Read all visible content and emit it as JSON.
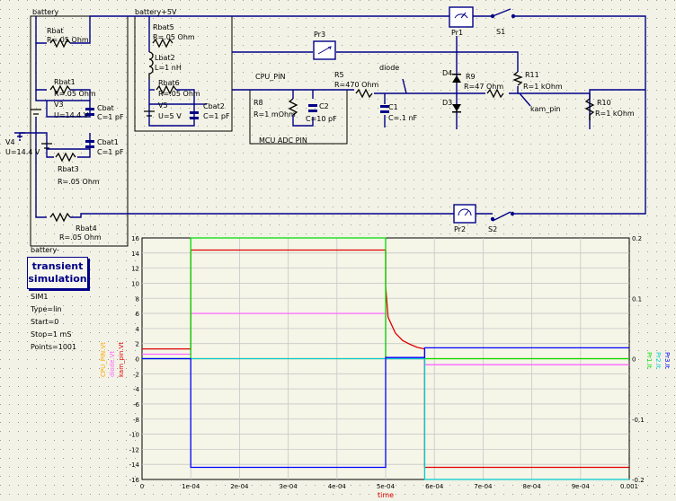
{
  "groups": {
    "battery": "battery",
    "battery_plus5v": "battery+5V",
    "battery_minus": "battery-",
    "mcu_adc": "MCU ADC PIN"
  },
  "components": {
    "rbat": {
      "name": "Rbat",
      "value": "R=.05 Ohm"
    },
    "rbat1": {
      "name": "Rbat1",
      "value": "R=.05 Ohm"
    },
    "v3": {
      "name": "V3",
      "value": "U=14.4 V"
    },
    "cbat": {
      "name": "Cbat",
      "value": "C=1 pF"
    },
    "v4": {
      "name": "V4",
      "value": "U=14.4 V"
    },
    "cbat1": {
      "name": "Cbat1",
      "value": "C=1 pF"
    },
    "rbat3": {
      "name": "Rbat3",
      "value": "R=.05 Ohm"
    },
    "rbat4": {
      "name": "Rbat4",
      "value": "R=.05 Ohm"
    },
    "rbat5": {
      "name": "Rbat5",
      "value": "R=.05 Ohm"
    },
    "lbat2": {
      "name": "Lbat2",
      "value": "L=1 nH"
    },
    "rbat6": {
      "name": "Rbat6",
      "value": "R=.05 Ohm"
    },
    "v5": {
      "name": "V5",
      "value": "U=5 V"
    },
    "cbat2": {
      "name": "Cbat2",
      "value": "C=1 pF"
    },
    "pr3": {
      "name": "Pr3"
    },
    "pr1": {
      "name": "Pr1"
    },
    "pr2": {
      "name": "Pr2"
    },
    "s1": {
      "name": "S1"
    },
    "s2": {
      "name": "S2"
    },
    "r8": {
      "name": "R8",
      "value": "R=1 mOhm"
    },
    "c2": {
      "name": "C2",
      "value": "C=10 pF"
    },
    "r5": {
      "name": "R5",
      "value": "R=470 Ohm"
    },
    "c1": {
      "name": "C1",
      "value": "C=.1 nF"
    },
    "d4": {
      "name": "D4"
    },
    "d3": {
      "name": "D3"
    },
    "r9": {
      "name": "R9",
      "value": "R=47 Ohm"
    },
    "r11": {
      "name": "R11",
      "value": "R=1 kOhm"
    },
    "r10": {
      "name": "R10",
      "value": "R=1 kOhm"
    }
  },
  "net_labels": {
    "cpu_pin": "CPU_PIN",
    "diode": "diode",
    "kam_pin": "kam_pin"
  },
  "simulation": {
    "title_line1": "transient",
    "title_line2": "simulation",
    "params": [
      "SIM1",
      "Type=lin",
      "Start=0",
      "Stop=1 mS",
      "Points=1001"
    ]
  },
  "chart_data": {
    "type": "line",
    "xlabel": "time",
    "x_ticks": [
      "0",
      "1e-04",
      "2e-04",
      "3e-04",
      "4e-04",
      "5e-04",
      "6e-04",
      "7e-04",
      "8e-04",
      "9e-04",
      "0.001"
    ],
    "xlim": [
      0,
      0.001
    ],
    "ylim": [
      -16,
      16
    ],
    "y_ticks": [
      "16",
      "14",
      "12",
      "10",
      "8",
      "6",
      "4",
      "2",
      "0",
      "-2",
      "-4",
      "-6",
      "-8",
      "-10",
      "-12",
      "-14",
      "-16"
    ],
    "y2lim": [
      -0.2,
      0.2
    ],
    "y2_ticks": [
      "0.2",
      "0.1",
      "0",
      "-0.1",
      "-0.2"
    ],
    "left_axis_labels": [
      {
        "text": "CPU_PIN.Vt",
        "color": "#ffaa00"
      },
      {
        "text": "diode.Vt",
        "color": "#ff66ff"
      },
      {
        "text": "kam_pin.Vt",
        "color": "#dd0000"
      }
    ],
    "right_axis_labels": [
      {
        "text": "Pr1.It",
        "color": "#00dd00"
      },
      {
        "text": "Pr2.It",
        "color": "#00cccc"
      },
      {
        "text": "Pr3.It",
        "color": "#0000ff"
      }
    ],
    "grid": true,
    "series": [
      {
        "name": "CPU_PIN.Vt",
        "axis": "left",
        "color": "#ffaa00",
        "points": [
          [
            0,
            0
          ],
          [
            0.001,
            0
          ]
        ]
      },
      {
        "name": "diode.Vt",
        "axis": "left",
        "color": "#ff66ff",
        "points": [
          [
            0,
            0.6
          ],
          [
            0.0001,
            0.6
          ],
          [
            0.0001,
            6
          ],
          [
            0.0005,
            6
          ],
          [
            0.0005,
            0
          ],
          [
            0.00058,
            0
          ],
          [
            0.00058,
            -0.8
          ],
          [
            0.001,
            -0.8
          ]
        ]
      },
      {
        "name": "kam_pin.Vt",
        "axis": "left",
        "color": "#dd0000",
        "points": [
          [
            0,
            1.3
          ],
          [
            0.0001,
            1.3
          ],
          [
            0.0001,
            14.4
          ],
          [
            0.0005,
            14.4
          ],
          [
            0.0005,
            9.6
          ],
          [
            0.000505,
            5.5
          ],
          [
            0.00052,
            3.4
          ],
          [
            0.000535,
            2.4
          ],
          [
            0.00055,
            1.9
          ],
          [
            0.000565,
            1.5
          ],
          [
            0.00058,
            1.3
          ],
          [
            0.00058,
            -14.4
          ],
          [
            0.001,
            -14.4
          ]
        ]
      },
      {
        "name": "Pr1.It",
        "axis": "right",
        "color": "#00dd00",
        "points": [
          [
            0,
            0
          ],
          [
            0.0001,
            0
          ],
          [
            0.0001,
            0.2
          ],
          [
            0.0005,
            0.2
          ],
          [
            0.0005,
            0
          ],
          [
            0.001,
            0
          ]
        ]
      },
      {
        "name": "Pr2.It",
        "axis": "right",
        "color": "#00cccc",
        "points": [
          [
            0,
            0
          ],
          [
            0.00058,
            0
          ],
          [
            0.00058,
            -0.2
          ],
          [
            0.001,
            -0.2
          ]
        ]
      },
      {
        "name": "Pr3.It",
        "axis": "right",
        "color": "#0000ff",
        "points": [
          [
            0,
            0
          ],
          [
            0.0001,
            0
          ],
          [
            0.0001,
            -0.18
          ],
          [
            0.0005,
            -0.18
          ],
          [
            0.0005,
            0.002
          ],
          [
            0.00058,
            0.002
          ],
          [
            0.00058,
            0.018
          ],
          [
            0.001,
            0.018
          ]
        ]
      }
    ]
  },
  "colors": {
    "wire": "#000088",
    "background": "#f2f2e6",
    "plot_background": "#f5f5e8"
  }
}
